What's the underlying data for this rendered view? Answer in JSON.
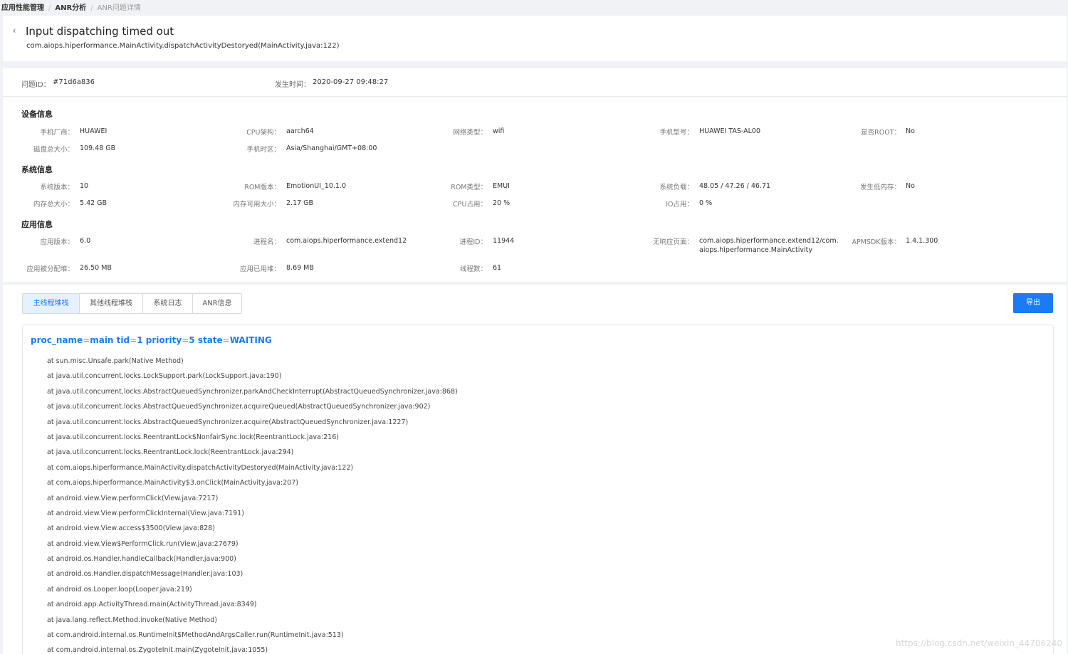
{
  "breadcrumb": [
    "应用性能管理",
    "ANR分析",
    "ANR问题详情"
  ],
  "header": {
    "title": "Input dispatching timed out",
    "subtitle": "com.aiops.hiperformance.MainActivity.dispatchActivityDestoryed(MainActivity.java:122)"
  },
  "issue": {
    "id_label": "问题ID：",
    "id_value": "#71d6a836",
    "time_label": "发生时间：",
    "time_value": "2020-09-27 09:48:27"
  },
  "device": {
    "title": "设备信息",
    "manufacturer_label": "手机厂商：",
    "manufacturer": "HUAWEI",
    "cpu_arch_label": "CPU架构：",
    "cpu_arch": "aarch64",
    "network_label": "网络类型：",
    "network": "wifi",
    "model_label": "手机型号：",
    "model": "HUAWEI TAS-AL00",
    "root_label": "是否ROOT：",
    "root": "No",
    "disk_label": "磁盘总大小：",
    "disk": "109.48 GB",
    "timezone_label": "手机时区：",
    "timezone": "Asia/Shanghai/GMT+08:00"
  },
  "system": {
    "title": "系统信息",
    "version_label": "系统版本：",
    "version": "10",
    "rom_version_label": "ROM版本：",
    "rom_version": "EmotionUI_10.1.0",
    "rom_type_label": "ROM类型：",
    "rom_type": "EMUI",
    "load_label": "系统负载：",
    "load": "48.05 / 47.26 / 46.71",
    "low_mem_label": "发生低内存：",
    "low_mem": "No",
    "mem_total_label": "内存总大小：",
    "mem_total": "5.42 GB",
    "mem_avail_label": "内存可用大小：",
    "mem_avail": "2.17 GB",
    "cpu_usage_label": "CPU占用：",
    "cpu_usage": "20 %",
    "io_label": "IO占用：",
    "io": "0 %"
  },
  "app": {
    "title": "应用信息",
    "version_label": "应用版本：",
    "version": "6.0",
    "process_label": "进程名：",
    "process": "com.aiops.hiperformance.extend12",
    "pid_label": "进程ID：",
    "pid": "11944",
    "page_label": "无响应页面：",
    "page_line1": "com.aiops.hiperformance.extend12/com.",
    "page_line2": "aiops.hiperformance.MainActivity",
    "apmsdk_label": "APMSDK版本：",
    "apmsdk": "1.4.1.300",
    "heap_alloc_label": "应用被分配堆：",
    "heap_alloc": "26.50 MB",
    "heap_used_label": "应用已用堆：",
    "heap_used": "8.69 MB",
    "threads_label": "线程数：",
    "threads": "61"
  },
  "tabs": [
    "主线程堆栈",
    "其他线程堆栈",
    "系统日志",
    "ANR信息"
  ],
  "export_label": "导出",
  "thread": {
    "k1": "proc_name",
    "eq": "=",
    "v1": "main",
    "k2": "tid",
    "v2": "1",
    "k3": "priority",
    "v3": "5",
    "k4": "state",
    "v4": "WAITING"
  },
  "frames": [
    "at sun.misc.Unsafe.park(Native Method)",
    "at java.util.concurrent.locks.LockSupport.park(LockSupport.java:190)",
    "at java.util.concurrent.locks.AbstractQueuedSynchronizer.parkAndCheckInterrupt(AbstractQueuedSynchronizer.java:868)",
    "at java.util.concurrent.locks.AbstractQueuedSynchronizer.acquireQueued(AbstractQueuedSynchronizer.java:902)",
    "at java.util.concurrent.locks.AbstractQueuedSynchronizer.acquire(AbstractQueuedSynchronizer.java:1227)",
    "at java.util.concurrent.locks.ReentrantLock$NonfairSync.lock(ReentrantLock.java:216)",
    "at java.util.concurrent.locks.ReentrantLock.lock(ReentrantLock.java:294)",
    "at com.aiops.hiperformance.MainActivity.dispatchActivityDestoryed(MainActivity.java:122)",
    "at com.aiops.hiperformance.MainActivity$3.onClick(MainActivity.java:207)",
    "at android.view.View.performClick(View.java:7217)",
    "at android.view.View.performClickInternal(View.java:7191)",
    "at android.view.View.access$3500(View.java:828)",
    "at android.view.View$PerformClick.run(View.java:27679)",
    "at android.os.Handler.handleCallback(Handler.java:900)",
    "at android.os.Handler.dispatchMessage(Handler.java:103)",
    "at android.os.Looper.loop(Looper.java:219)",
    "at android.app.ActivityThread.main(ActivityThread.java:8349)",
    "at java.lang.reflect.Method.invoke(Native Method)",
    "at com.android.internal.os.RuntimeInit$MethodAndArgsCaller.run(RuntimeInit.java:513)",
    "at com.android.internal.os.ZygoteInit.main(ZygoteInit.java:1055)"
  ],
  "watermark": "https://blog.csdn.net/weixin_44706240"
}
